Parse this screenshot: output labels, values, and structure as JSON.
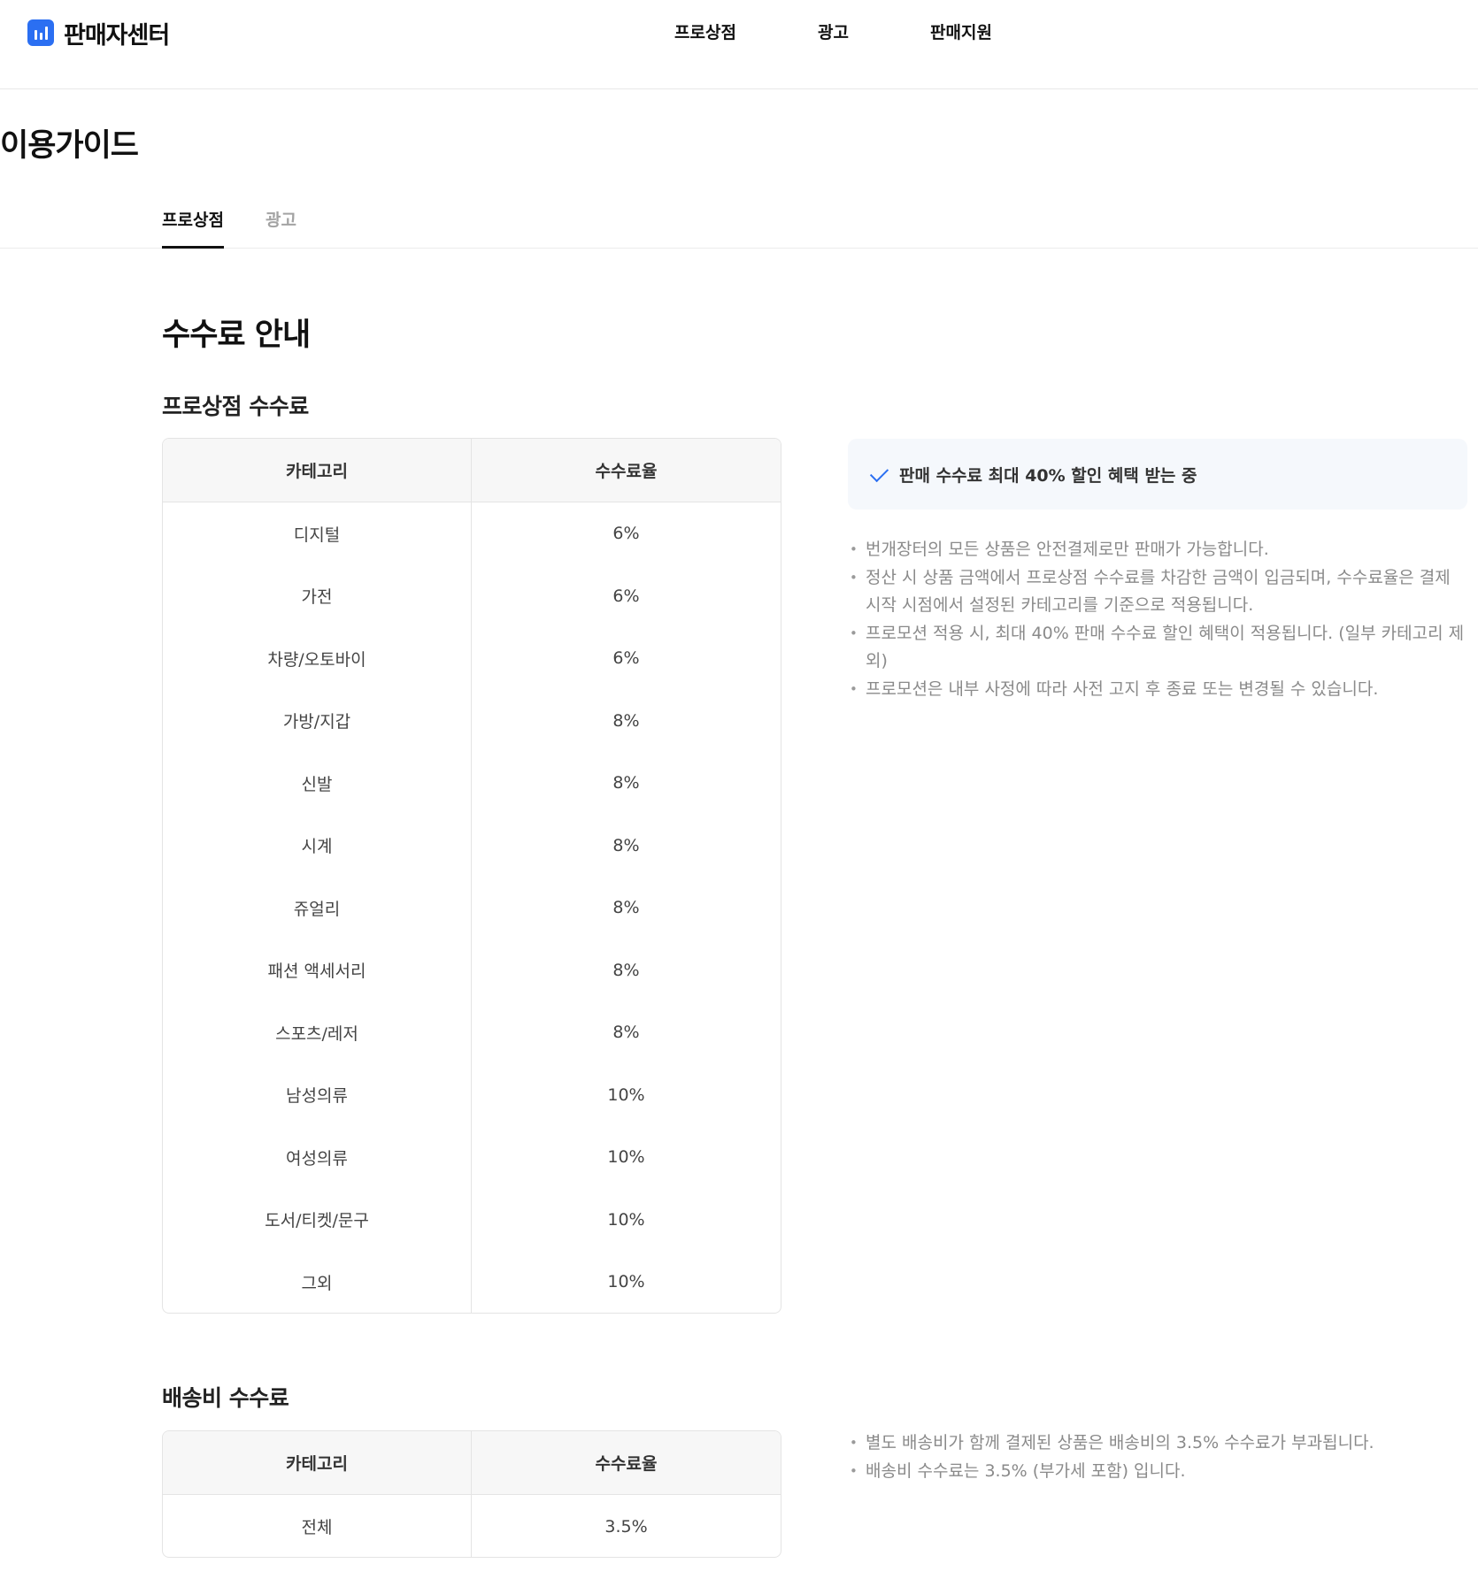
{
  "header": {
    "brand": "판매자센터",
    "nav": [
      "프로상점",
      "광고",
      "판매지원"
    ]
  },
  "page": {
    "title": "이용가이드",
    "tabs": [
      {
        "label": "프로상점",
        "active": true
      },
      {
        "label": "광고",
        "active": false
      }
    ]
  },
  "fee_guide": {
    "title": "수수료 안내",
    "pro_shop": {
      "title": "프로상점 수수료",
      "columns": [
        "카테고리",
        "수수료율"
      ],
      "rows": [
        [
          "디지털",
          "6%"
        ],
        [
          "가전",
          "6%"
        ],
        [
          "차량/오토바이",
          "6%"
        ],
        [
          "가방/지갑",
          "8%"
        ],
        [
          "신발",
          "8%"
        ],
        [
          "시계",
          "8%"
        ],
        [
          "쥬얼리",
          "8%"
        ],
        [
          "패션 액세서리",
          "8%"
        ],
        [
          "스포츠/레저",
          "8%"
        ],
        [
          "남성의류",
          "10%"
        ],
        [
          "여성의류",
          "10%"
        ],
        [
          "도서/티켓/문구",
          "10%"
        ],
        [
          "그외",
          "10%"
        ]
      ],
      "promo_banner": "판매 수수료 최대 40% 할인 혜택 받는 중",
      "notes": [
        "번개장터의 모든 상품은 안전결제로만 판매가 가능합니다.",
        "정산 시 상품 금액에서 프로상점 수수료를 차감한 금액이 입금되며, 수수료율은 결제 시작 시점에서 설정된 카테고리를 기준으로 적용됩니다.",
        "프로모션 적용 시, 최대 40% 판매 수수료 할인 혜택이 적용됩니다. (일부 카테고리 제외)",
        "프로모션은 내부 사정에 따라 사전 고지 후 종료 또는 변경될 수 있습니다."
      ]
    },
    "shipping": {
      "title": "배송비 수수료",
      "columns": [
        "카테고리",
        "수수료율"
      ],
      "rows": [
        [
          "전체",
          "3.5%"
        ]
      ],
      "notes": [
        "별도 배송비가 함께 결제된 상품은 배송비의 3.5% 수수료가 부과됩니다.",
        "배송비 수수료는 3.5% (부가세 포함) 입니다."
      ]
    }
  },
  "colors": {
    "brand": "#2b6ff2",
    "promo_bg": "#f5f8fc",
    "note_text": "#8a8a8a"
  }
}
